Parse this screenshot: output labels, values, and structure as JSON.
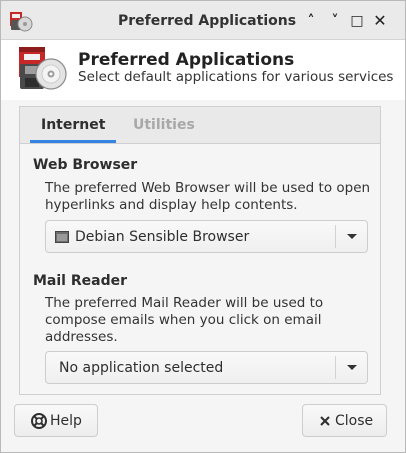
{
  "window": {
    "title": "Preferred Applications",
    "controls": {
      "shade_up": "˄",
      "shade_down": "˅",
      "maximize": "□",
      "close": "✕"
    }
  },
  "header": {
    "title": "Preferred Applications",
    "subtitle": "Select default applications for various services",
    "icon": "preferred-applications-icon"
  },
  "tabs": [
    {
      "label": "Internet",
      "active": true
    },
    {
      "label": "Utilities",
      "active": false
    }
  ],
  "web_browser": {
    "title": "Web Browser",
    "description": "The preferred Web Browser will be used to open hyperlinks and display help contents.",
    "selected": "Debian Sensible Browser",
    "selected_icon": "browser-window-icon"
  },
  "mail_reader": {
    "title": "Mail Reader",
    "description": "The preferred Mail Reader will be used to compose emails when you click on email addresses.",
    "selected": "No application selected"
  },
  "buttons": {
    "help": "Help",
    "help_icon": "lifebuoy-icon",
    "close": "Close",
    "close_icon": "close-x-icon"
  },
  "colors": {
    "tab_accent": "#3584e4",
    "inactive_tab": "#a8a8a8"
  }
}
